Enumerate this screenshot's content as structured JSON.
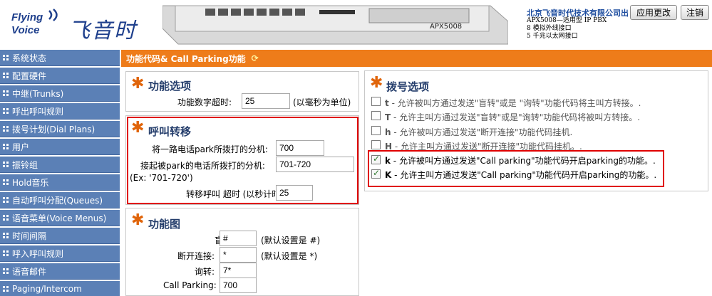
{
  "header": {
    "logo_text_line1": "Flying",
    "logo_text_line2": "Voice",
    "logo_cn": "飞音时代",
    "company": "北京飞音时代技术有限公司出",
    "product_lines": [
      "APX5008—适用型 IP PBX",
      "8 模拟外线接口",
      "5 千兆以太网接口"
    ],
    "device_label": "APX5008",
    "apply_button": "应用更改",
    "logout_button": "注销"
  },
  "nav": {
    "items": [
      "系统状态",
      "配置硬件",
      "中继(Trunks)",
      "呼出呼叫规则",
      "拨号计划(Dial Plans)",
      "用户",
      "振铃组",
      "Hold音乐",
      "自动呼叫分配(Queues)",
      "语音菜单(Voice Menus)",
      "时间间隔",
      "呼入呼叫规则",
      "语音邮件",
      "Paging/Intercom"
    ]
  },
  "page": {
    "title": "功能代码& Call Parking功能"
  },
  "function_options": {
    "title": "功能选项",
    "timeout_label": "功能数字超时:",
    "timeout_value": "25",
    "timeout_unit": "(以毫秒为单位)"
  },
  "call_transfer": {
    "title": "呼叫转移",
    "park_ext_label": "将一路电话park所拨打的分机:",
    "park_ext_value": "700",
    "pickup_ext_label": "接起被park的电话所拨打的分机:",
    "pickup_ext_value": "701-720",
    "example": "(Ex: '701-720')",
    "timeout_label": "转移呼叫 超时 (以秒计时):",
    "timeout_value": "25"
  },
  "feature_map": {
    "title": "功能图",
    "blind_label": "盲转:",
    "blind_value": "#",
    "blind_default": "(默认设置是 #)",
    "disconnect_label": "断开连接:",
    "disconnect_value": "*",
    "disconnect_default": "(默认设置是 *)",
    "attended_label": "询转:",
    "attended_value": "7*",
    "parking_label": "Call Parking:",
    "parking_value": "700"
  },
  "dial_options": {
    "title": "拨号选项",
    "items": [
      {
        "key": "t",
        "text": " - 允许被叫方通过发送\"盲转\"或是 \"询转\"功能代码将主叫方转接。.",
        "checked": false
      },
      {
        "key": "T",
        "text": " - 允许主叫方通过发送\"盲转\"或是\"询转\"功能代码将被叫方转接。.",
        "checked": false
      },
      {
        "key": "h",
        "text": " - 允许被叫方通过发送\"断开连接\"功能代码挂机.",
        "checked": false
      },
      {
        "key": "H",
        "text": " - 允许主叫方通过发送\"断开连接\"功能代码挂机。.",
        "checked": false
      },
      {
        "key": "k",
        "text": " - 允许被叫方通过发送\"Call parking\"功能代码开启parking的功能。.",
        "checked": true
      },
      {
        "key": "K",
        "text": " - 允许主叫方通过发送\"Call parking\"功能代码开启parking的功能。.",
        "checked": true
      }
    ]
  },
  "colors": {
    "nav_bg": "#5b80b6",
    "title_bar": "#ee7c1a",
    "highlight": "#e00000",
    "star": "#e0640a"
  }
}
